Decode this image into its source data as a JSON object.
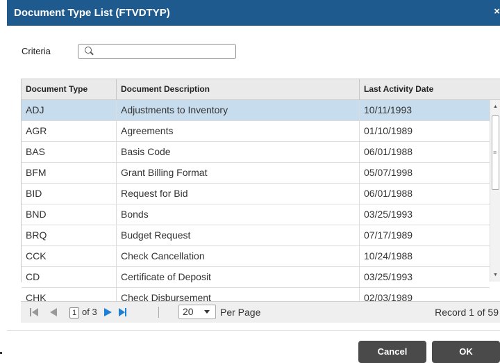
{
  "dialog": {
    "title": "Document Type List (FTVDTYP)",
    "close_label": "×"
  },
  "criteria": {
    "label": "Criteria",
    "value": "",
    "placeholder": ""
  },
  "columns": [
    "Document Type",
    "Document Description",
    "Last Activity Date"
  ],
  "rows": [
    {
      "type": "ADJ",
      "desc": "Adjustments to Inventory",
      "date": "10/11/1993"
    },
    {
      "type": "AGR",
      "desc": "Agreements",
      "date": "01/10/1989"
    },
    {
      "type": "BAS",
      "desc": "Basis Code",
      "date": "06/01/1988"
    },
    {
      "type": "BFM",
      "desc": "Grant Billing Format",
      "date": "05/07/1998"
    },
    {
      "type": "BID",
      "desc": "Request for Bid",
      "date": "06/01/1988"
    },
    {
      "type": "BND",
      "desc": "Bonds",
      "date": "03/25/1993"
    },
    {
      "type": "BRQ",
      "desc": "Budget Request",
      "date": "07/17/1989"
    },
    {
      "type": "CCK",
      "desc": "Check Cancellation",
      "date": "10/24/1988"
    },
    {
      "type": "CD",
      "desc": "Certificate of Deposit",
      "date": "03/25/1993"
    },
    {
      "type": "CHK",
      "desc": "Check Disbursement",
      "date": "02/03/1989"
    }
  ],
  "pager": {
    "page": "1",
    "of_pages": "of 3",
    "per_page_value": "20",
    "per_page_label": "Per Page",
    "record_text": "Record 1 of 59"
  },
  "buttons": {
    "cancel": "Cancel",
    "ok": "OK"
  },
  "colors": {
    "title_bar": "#1e5a8e",
    "selected_row": "#c7dcec",
    "button": "#4a4a4a",
    "pager_active": "#1d7fd6"
  },
  "icons": [
    "close-icon",
    "search-icon",
    "first-page-icon",
    "prev-page-icon",
    "next-page-icon",
    "last-page-icon",
    "chevron-down-icon"
  ]
}
